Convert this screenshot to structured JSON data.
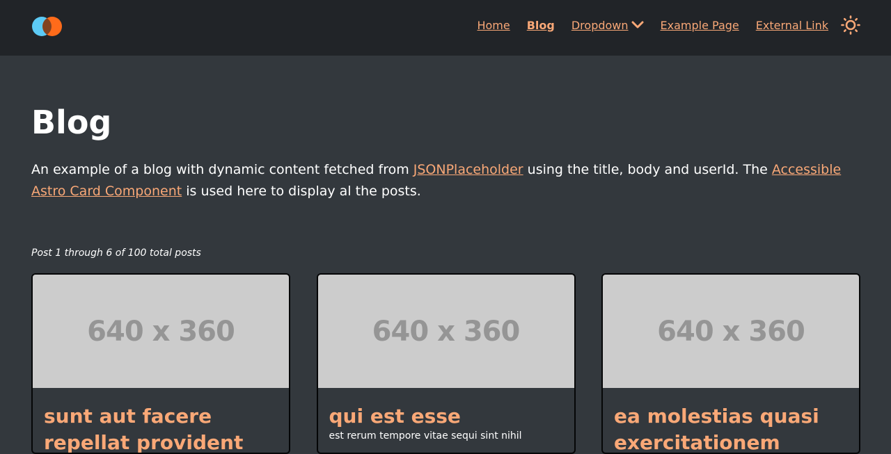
{
  "header": {
    "nav": {
      "home": "Home",
      "blog": "Blog",
      "dropdown": "Dropdown",
      "example_page": "Example Page",
      "external_link": "External Link"
    },
    "icons": {
      "logo": "logo-icon",
      "dropdown_chevron": "chevron-down-icon",
      "theme_toggle": "sun-icon"
    }
  },
  "main": {
    "title": "Blog",
    "intro": {
      "part1": "An example of a blog with dynamic content fetched from ",
      "link1": "JSONPlaceholder",
      "part2": " using the title, body and userId. The ",
      "link2": "Accessible Astro Card Component",
      "part3": " is used here to display al the posts."
    },
    "post_count": "Post 1 through 6 of 100 total posts",
    "cards": [
      {
        "image_text": "640 x 360",
        "title": "sunt aut facere repellat provident",
        "body": ""
      },
      {
        "image_text": "640 x 360",
        "title": "qui est esse",
        "body": "est rerum tempore vitae sequi sint nihil"
      },
      {
        "image_text": "640 x 360",
        "title": "ea molestias quasi exercitationem",
        "body": ""
      }
    ]
  },
  "colors": {
    "background": "#33383d",
    "header_background": "#212428",
    "accent": "#f9a877",
    "logo_blue": "#5ccaf5",
    "logo_orange": "#ff6b1a",
    "placeholder_gray": "#cccccc"
  }
}
